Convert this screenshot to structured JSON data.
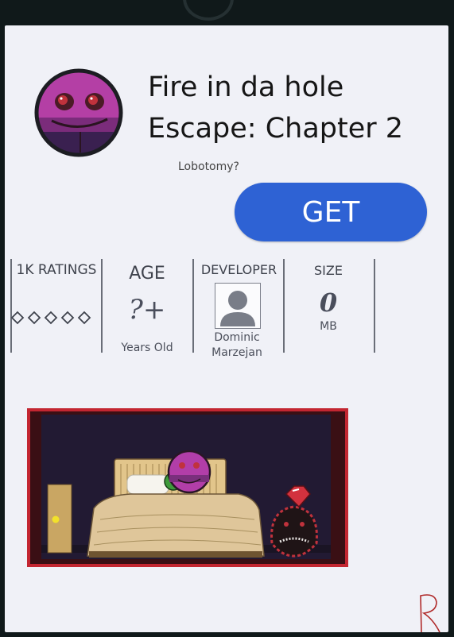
{
  "app": {
    "title": "Fire in da hole Escape: Chapter 2",
    "subtitle": "Lobotomy?",
    "get_label": "GET"
  },
  "stats": {
    "ratings": {
      "label": "1K RATINGS",
      "stars_filled": 0,
      "stars_total": 5
    },
    "age": {
      "label": "AGE",
      "value": "?+",
      "sub": "Years Old"
    },
    "developer": {
      "label": "DEVELOPER",
      "name": "Dominic Marzejan"
    },
    "size": {
      "label": "SIZE",
      "value": "0",
      "unit": "MB"
    }
  },
  "colors": {
    "get_button": "#2e62d4",
    "background": "#f0f1f7",
    "frame": "#10191a"
  },
  "icons": [
    "app-icon",
    "star-outline-icon",
    "person-silhouette-icon"
  ],
  "signature": "R"
}
